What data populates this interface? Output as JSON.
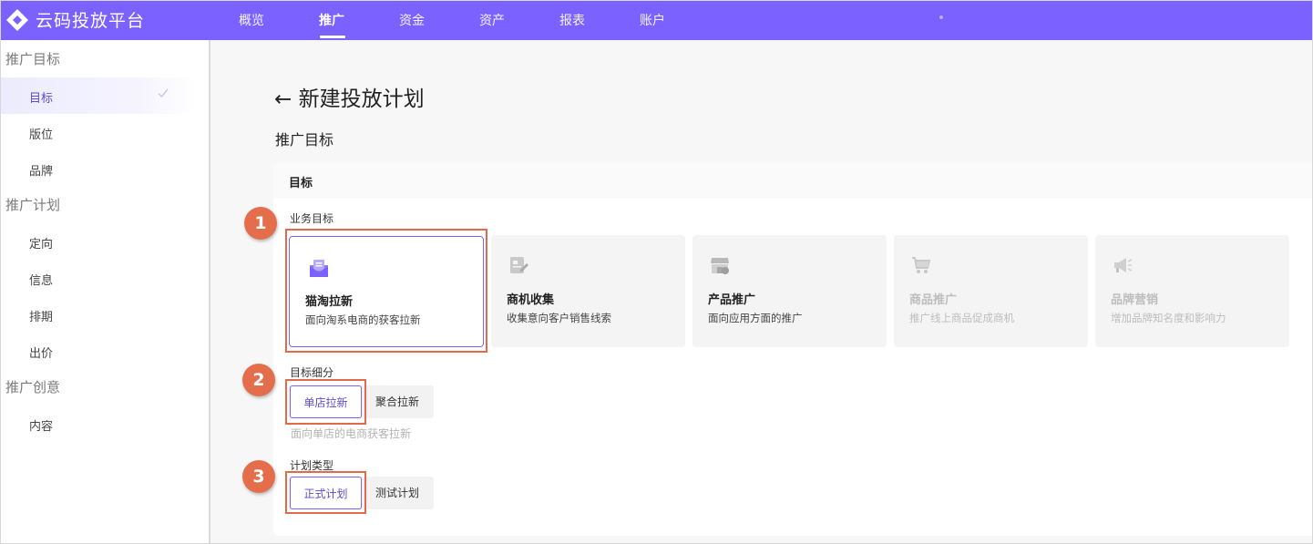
{
  "app": {
    "brand": "云码投放平台"
  },
  "nav": {
    "items": [
      {
        "label": "概览"
      },
      {
        "label": "推广"
      },
      {
        "label": "资金"
      },
      {
        "label": "资产"
      },
      {
        "label": "报表"
      },
      {
        "label": "账户"
      }
    ],
    "active": "推广"
  },
  "sidebar": {
    "groups": [
      {
        "title": "推广目标",
        "items": [
          {
            "label": "目标",
            "active": true,
            "done": true
          },
          {
            "label": "版位"
          },
          {
            "label": "品牌"
          }
        ]
      },
      {
        "title": "推广计划",
        "items": [
          {
            "label": "定向"
          },
          {
            "label": "信息"
          },
          {
            "label": "排期"
          },
          {
            "label": "出价"
          }
        ]
      },
      {
        "title": "推广创意",
        "items": [
          {
            "label": "内容"
          }
        ]
      }
    ]
  },
  "page": {
    "back_arrow": "←",
    "title": "新建投放计划",
    "section_title": "推广目标",
    "card_title": "目标"
  },
  "business_goal": {
    "label": "业务目标",
    "options": [
      {
        "title": "猫淘拉新",
        "desc": "面向淘系电商的获客拉新",
        "icon": "mail-icon",
        "selected": true
      },
      {
        "title": "商机收集",
        "desc": "收集意向客户销售线索",
        "icon": "form-edit-icon"
      },
      {
        "title": "产品推广",
        "desc": "面向应用方面的推广",
        "icon": "store-icon"
      },
      {
        "title": "商品推广",
        "desc": "推广线上商品促成商机",
        "icon": "cart-icon",
        "disabled": true
      },
      {
        "title": "品牌营销",
        "desc": "增加品牌知名度和影响力",
        "icon": "megaphone-icon",
        "disabled": true
      }
    ]
  },
  "goal_breakdown": {
    "label": "目标细分",
    "options": [
      {
        "label": "单店拉新",
        "selected": true
      },
      {
        "label": "聚合拉新"
      }
    ],
    "hint": "面向单店的电商获客拉新"
  },
  "plan_type": {
    "label": "计划类型",
    "options": [
      {
        "label": "正式计划",
        "selected": true
      },
      {
        "label": "测试计划"
      }
    ]
  },
  "annotations": [
    "1",
    "2",
    "3"
  ],
  "colors": {
    "brand": "#7b61ff",
    "highlight": "#e06a4a",
    "badge": "#e46e4b"
  }
}
